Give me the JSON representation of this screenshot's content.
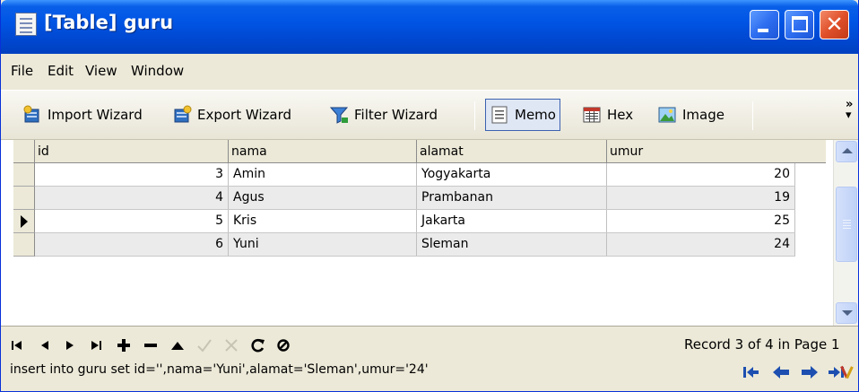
{
  "window": {
    "title": "[Table] guru"
  },
  "menu": [
    "File",
    "Edit",
    "View",
    "Window"
  ],
  "toolbar": {
    "import_wizard": "Import Wizard",
    "export_wizard": "Export Wizard",
    "filter_wizard": "Filter Wizard",
    "memo": "Memo",
    "hex": "Hex",
    "image": "Image",
    "overflow": "»"
  },
  "grid": {
    "columns": [
      "id",
      "nama",
      "alamat",
      "umur"
    ],
    "rows": [
      {
        "id": "3",
        "nama": "Amin",
        "alamat": "Yogyakarta",
        "umur": "20"
      },
      {
        "id": "4",
        "nama": "Agus",
        "alamat": "Prambanan",
        "umur": "19"
      },
      {
        "id": "5",
        "nama": "Kris",
        "alamat": "Jakarta",
        "umur": "25"
      },
      {
        "id": "6",
        "nama": "Yuni",
        "alamat": "Sleman",
        "umur": "24"
      }
    ],
    "current_row": 2
  },
  "status": {
    "record_info": "Record 3 of 4 in Page 1",
    "sql": "insert into guru set id='',nama='Yuni',alamat='Sleman',umur='24'"
  },
  "colors": {
    "title_bar": "#0055e5",
    "close_button": "#e0502a",
    "row_alt": "#ebebeb",
    "active_tool": "#dfe6f4"
  },
  "icons": [
    "table-icon",
    "import-wizard-icon",
    "export-wizard-icon",
    "filter-wizard-icon",
    "memo-icon",
    "hex-icon",
    "image-icon"
  ]
}
